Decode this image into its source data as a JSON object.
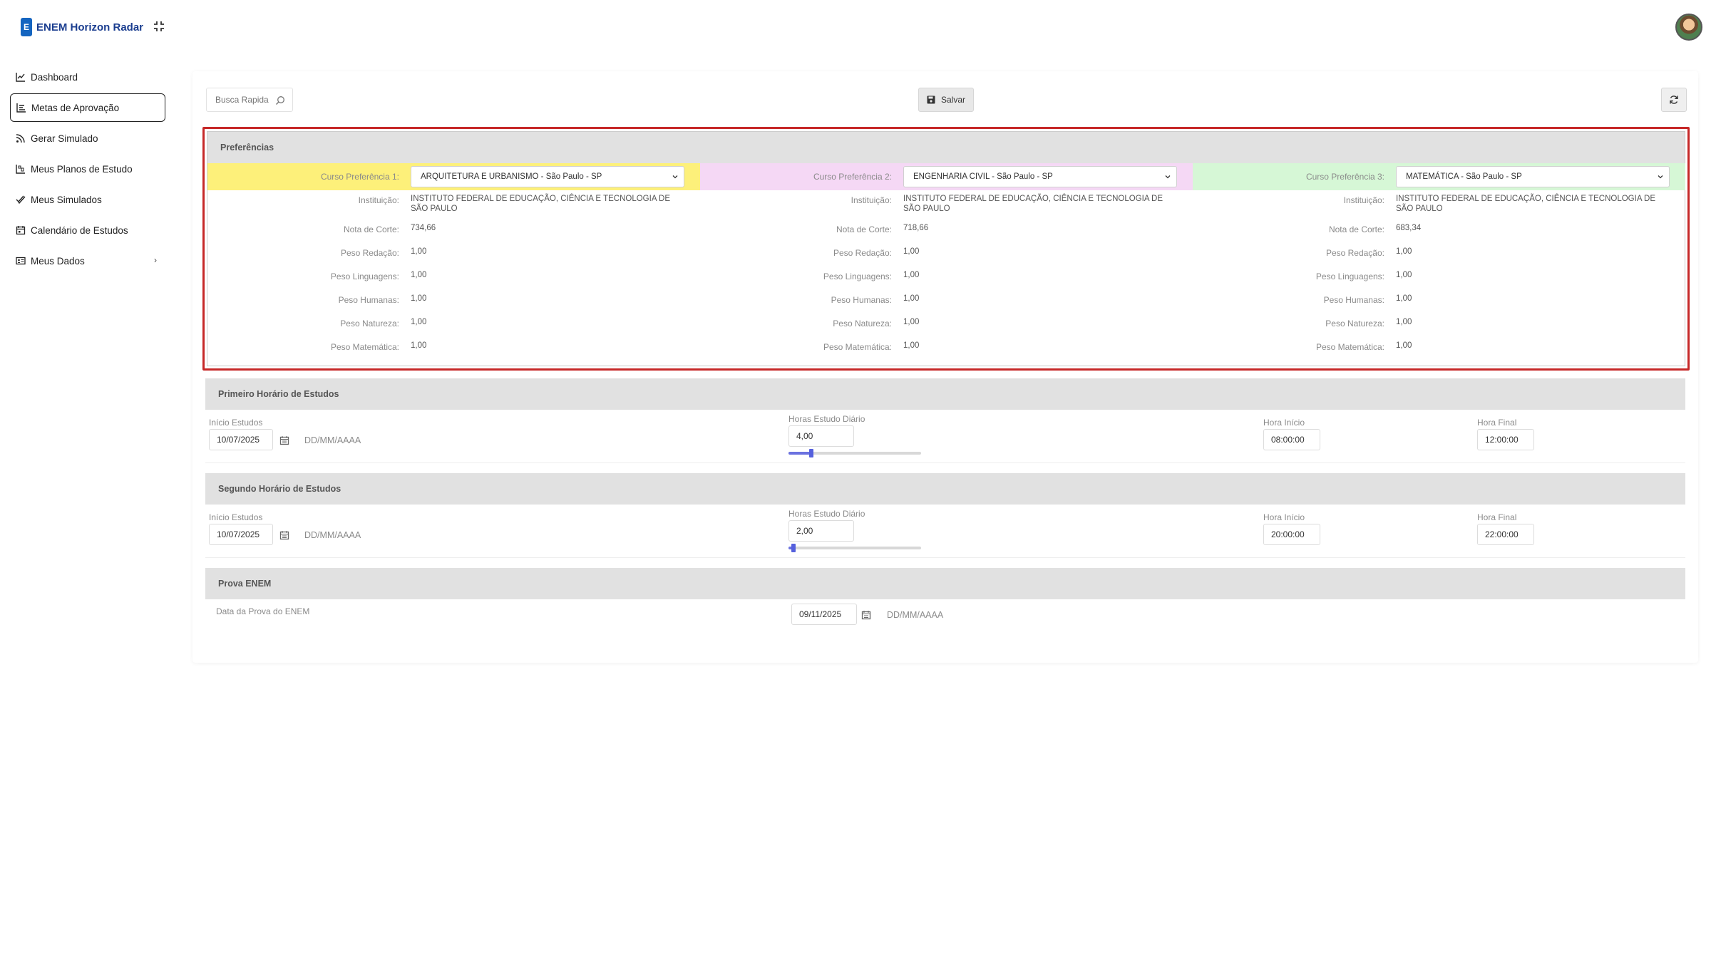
{
  "app": {
    "brand_letter": "E",
    "brand_name": "ENEM Horizon Radar"
  },
  "sidebar": {
    "items": [
      {
        "label": "Dashboard",
        "icon": "chart-line-icon"
      },
      {
        "label": "Metas de Aprovação",
        "icon": "chart-bar-icon",
        "active": true
      },
      {
        "label": "Gerar Simulado",
        "icon": "rss-icon"
      },
      {
        "label": "Meus Planos de Estudo",
        "icon": "planner-icon"
      },
      {
        "label": "Meus Simulados",
        "icon": "check-double-icon"
      },
      {
        "label": "Calendário de Estudos",
        "icon": "calendar-icon"
      },
      {
        "label": "Meus Dados",
        "icon": "id-card-icon",
        "chevron": "›"
      }
    ]
  },
  "toolbar": {
    "search_placeholder": "Busca Rapida",
    "save_label": "Salvar"
  },
  "preferences": {
    "title": "Preferências",
    "labels": {
      "instituicao": "Instituição:",
      "nota": "Nota de Corte:",
      "redacao": "Peso Redação:",
      "linguagens": "Peso Linguagens:",
      "humanas": "Peso Humanas:",
      "natureza": "Peso Natureza:",
      "matematica": "Peso Matemática:"
    },
    "columns": [
      {
        "label": "Curso Preferência 1:",
        "course": "ARQUITETURA E URBANISMO - São Paulo - SP",
        "color": "#fdf07a",
        "instituicao": "INSTITUTO FEDERAL DE EDUCAÇÃO, CIÊNCIA E TECNOLOGIA DE SÃO PAULO",
        "nota": "734,66",
        "redacao": "1,00",
        "linguagens": "1,00",
        "humanas": "1,00",
        "natureza": "1,00",
        "matematica": "1,00"
      },
      {
        "label": "Curso Preferência 2:",
        "course": "ENGENHARIA CIVIL - São Paulo - SP",
        "color": "#f5d8f5",
        "instituicao": "INSTITUTO FEDERAL DE EDUCAÇÃO, CIÊNCIA E TECNOLOGIA DE SÃO PAULO",
        "nota": "718,66",
        "redacao": "1,00",
        "linguagens": "1,00",
        "humanas": "1,00",
        "natureza": "1,00",
        "matematica": "1,00"
      },
      {
        "label": "Curso Preferência 3:",
        "course": "MATEMÁTICA - São Paulo - SP",
        "color": "#d6f7d6",
        "instituicao": "INSTITUTO FEDERAL DE EDUCAÇÃO, CIÊNCIA E TECNOLOGIA DE SÃO PAULO",
        "nota": "683,34",
        "redacao": "1,00",
        "linguagens": "1,00",
        "humanas": "1,00",
        "natureza": "1,00",
        "matematica": "1,00"
      }
    ]
  },
  "schedule1": {
    "title": "Primeiro Horário de Estudos",
    "inicio_label": "Início Estudos",
    "inicio_value": "10/07/2025",
    "date_format": "DD/MM/AAAA",
    "horas_label": "Horas Estudo Diário",
    "horas_value": "4,00",
    "horas_fraction": 0.17,
    "hora_inicio_label": "Hora Início",
    "hora_inicio_value": "08:00:00",
    "hora_final_label": "Hora Final",
    "hora_final_value": "12:00:00"
  },
  "schedule2": {
    "title": "Segundo Horário de Estudos",
    "inicio_label": "Início Estudos",
    "inicio_value": "10/07/2025",
    "date_format": "DD/MM/AAAA",
    "horas_label": "Horas Estudo Diário",
    "horas_value": "2,00",
    "horas_fraction": 0.04,
    "hora_inicio_label": "Hora Início",
    "hora_inicio_value": "20:00:00",
    "hora_final_label": "Hora Final",
    "hora_final_value": "22:00:00"
  },
  "prova": {
    "title": "Prova ENEM",
    "label": "Data da Prova do ENEM",
    "value": "09/11/2025",
    "date_format": "DD/MM/AAAA"
  }
}
